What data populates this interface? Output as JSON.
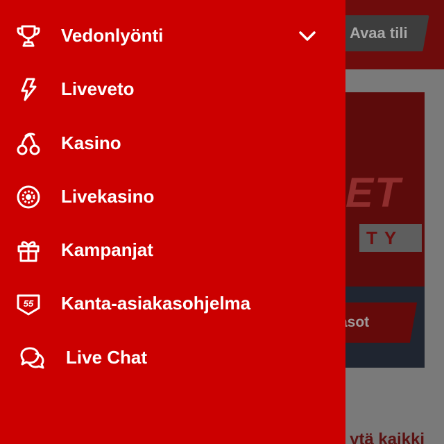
{
  "background": {
    "header_button_label": "Avaa tili",
    "banner_button_label": "tasot",
    "footer_text": "ytä kaikki",
    "banner_logo_text": "ET",
    "banner_sub_text": "TY"
  },
  "menu": {
    "items": [
      {
        "label": "Vedonlyönti",
        "icon": "trophy-icon",
        "has_chevron": true
      },
      {
        "label": "Liveveto",
        "icon": "lightning-icon"
      },
      {
        "label": "Kasino",
        "icon": "cherries-icon"
      },
      {
        "label": "Livekasino",
        "icon": "roulette-icon"
      },
      {
        "label": "Kampanjat",
        "icon": "gift-icon"
      },
      {
        "label": "Kanta-asiakasohjelma",
        "icon": "loyalty-badge-icon",
        "badge_text": "55"
      },
      {
        "label": "Live Chat",
        "icon": "chat-bubbles-icon"
      }
    ]
  },
  "colors": {
    "drawer": "#cc0000",
    "text": "#ffffff",
    "overlay_dim": "#6f6f6f"
  }
}
